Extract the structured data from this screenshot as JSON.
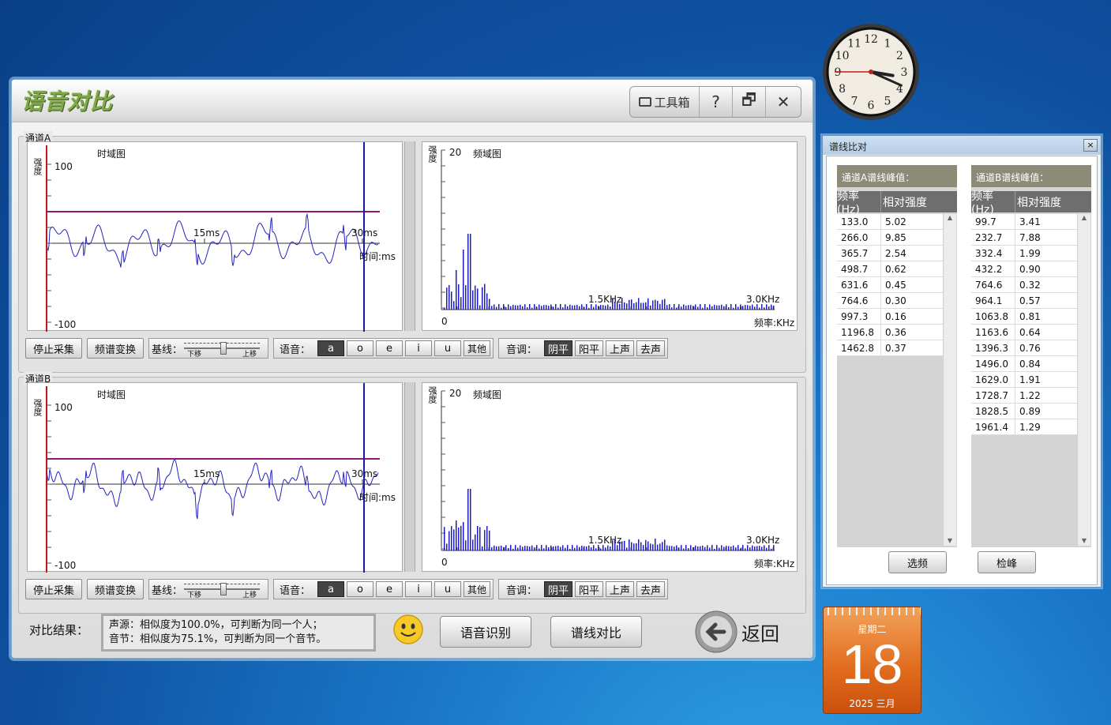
{
  "app": {
    "title": "语音对比"
  },
  "toolbar": {
    "toolbox": "工具箱",
    "help": "?",
    "restore": "🗗",
    "close": "✕"
  },
  "channels": [
    {
      "label": "通道A",
      "time": {
        "title": "时域图",
        "y_axis": "强度",
        "y_top": "100",
        "y_bottom": "-100",
        "t15": "15ms",
        "t30": "30ms",
        "t_unit": "时间:ms"
      },
      "freq": {
        "title": "频域图",
        "y_axis": "强度",
        "y_top": "20",
        "f0": "0",
        "f15": "1.5KHz",
        "f30": "3.0KHz",
        "f_unit": "频率:KHz"
      },
      "controls": {
        "stop": "停止采集",
        "fft": "频谱变换",
        "baseline": "基线：",
        "down": "下移",
        "up": "上移",
        "vowel": "语音：",
        "vowels": [
          "a",
          "o",
          "e",
          "i",
          "u",
          "其他"
        ],
        "vowel_selected": "a",
        "tone": "音调：",
        "tones": [
          "阴平",
          "阳平",
          "上声",
          "去声"
        ],
        "tone_selected": "阴平"
      }
    },
    {
      "label": "通道B",
      "time": {
        "title": "时域图",
        "y_axis": "强度",
        "y_top": "100",
        "y_bottom": "-100",
        "t15": "15ms",
        "t30": "30ms",
        "t_unit": "时间:ms"
      },
      "freq": {
        "title": "频域图",
        "y_axis": "强度",
        "y_top": "20",
        "f0": "0",
        "f15": "1.5KHz",
        "f30": "3.0KHz",
        "f_unit": "频率:KHz"
      },
      "controls": {
        "stop": "停止采集",
        "fft": "频谱变换",
        "baseline": "基线：",
        "down": "下移",
        "up": "上移",
        "vowel": "语音：",
        "vowels": [
          "a",
          "o",
          "e",
          "i",
          "u",
          "其他"
        ],
        "vowel_selected": "a",
        "tone": "音调：",
        "tones": [
          "阴平",
          "阳平",
          "上声",
          "去声"
        ],
        "tone_selected": "阴平"
      }
    }
  ],
  "bottom": {
    "result_label": "对比结果：",
    "result_line1": "声源：相似度为100.0%，可判断为同一个人；",
    "result_line2": "音节：相似度为75.1%，可判断为同一个音节。",
    "recognize": "语音识别",
    "compare": "谱线对比",
    "back": "返回"
  },
  "spectrum_window": {
    "title": "谱线比对",
    "close": "×",
    "panel_a": {
      "title": "通道A谱线峰值：",
      "col_freq": "频率(Hz)",
      "col_intensity": "相对强度",
      "rows": [
        [
          "133.0",
          "5.02"
        ],
        [
          "266.0",
          "9.85"
        ],
        [
          "365.7",
          "2.54"
        ],
        [
          "498.7",
          "0.62"
        ],
        [
          "631.6",
          "0.45"
        ],
        [
          "764.6",
          "0.30"
        ],
        [
          "997.3",
          "0.16"
        ],
        [
          "1196.8",
          "0.36"
        ],
        [
          "1462.8",
          "0.37"
        ]
      ]
    },
    "panel_b": {
      "title": "通道B谱线峰值：",
      "col_freq": "频率(Hz)",
      "col_intensity": "相对强度",
      "rows": [
        [
          "99.7",
          "3.41"
        ],
        [
          "232.7",
          "7.88"
        ],
        [
          "332.4",
          "1.99"
        ],
        [
          "432.2",
          "0.90"
        ],
        [
          "764.6",
          "0.32"
        ],
        [
          "964.1",
          "0.57"
        ],
        [
          "1063.8",
          "0.81"
        ],
        [
          "1163.6",
          "0.64"
        ],
        [
          "1396.3",
          "0.76"
        ],
        [
          "1496.0",
          "0.84"
        ],
        [
          "1629.0",
          "1.91"
        ],
        [
          "1728.7",
          "1.22"
        ],
        [
          "1828.5",
          "0.89"
        ],
        [
          "1961.4",
          "1.29"
        ]
      ]
    },
    "select_freq": "选频",
    "detect_peak": "检峰"
  },
  "calendar": {
    "weekday": "星期二",
    "day": "18",
    "year_month": "2025 三月"
  },
  "clock": {
    "numbers": [
      "12",
      "1",
      "2",
      "3",
      "4",
      "5",
      "6",
      "7",
      "8",
      "9",
      "10",
      "11"
    ],
    "hour": 3,
    "minute": 19,
    "second": 45
  }
}
